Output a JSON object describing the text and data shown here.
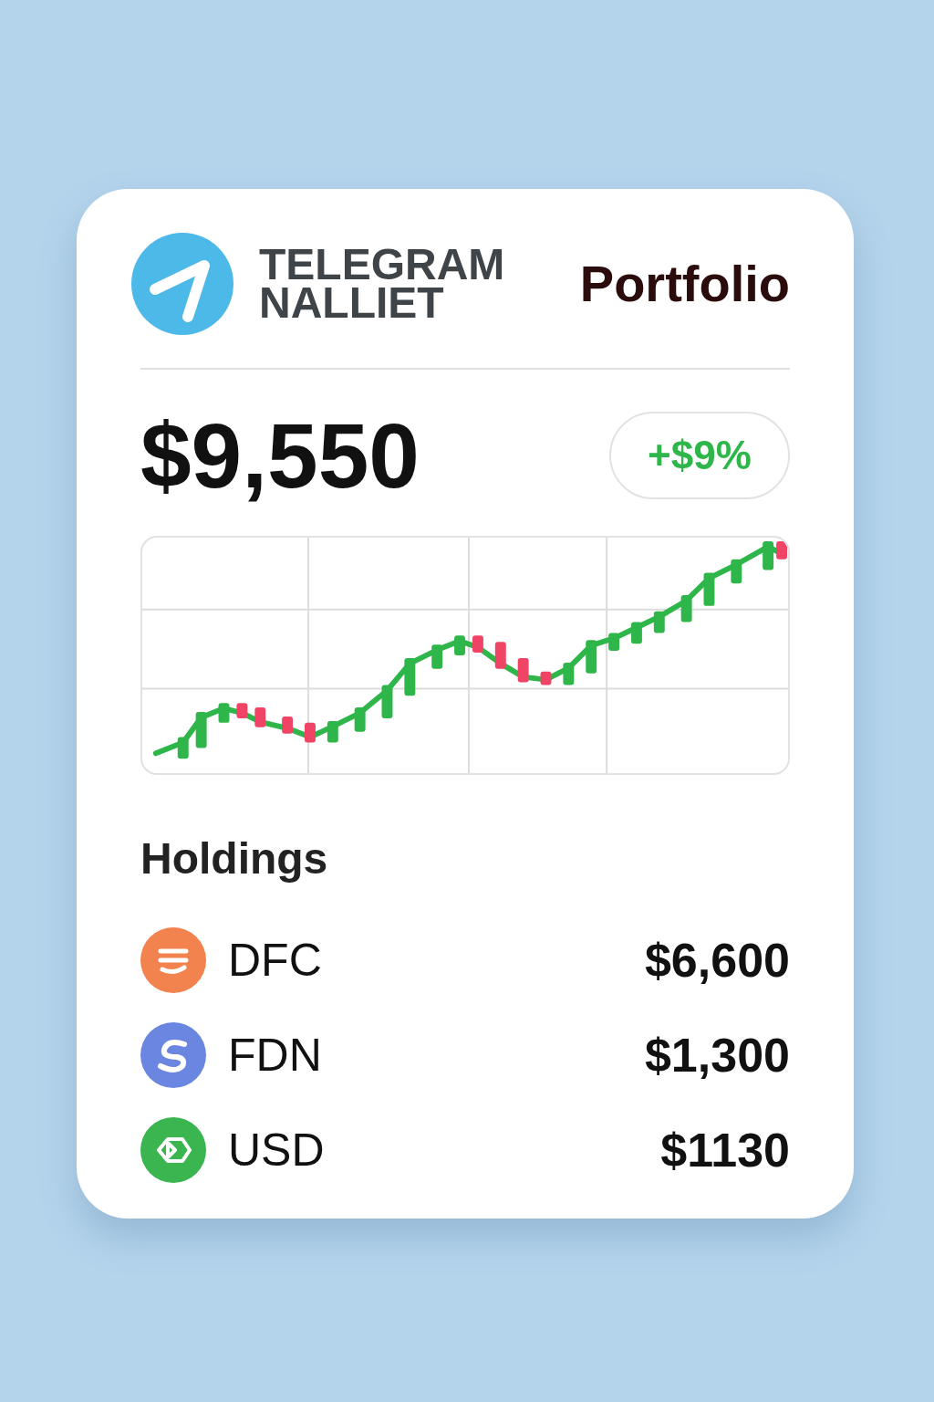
{
  "header": {
    "brand_line_1": "TELEGRAM",
    "brand_line_2": "NALLIET",
    "title": "Portfolio"
  },
  "balance": {
    "amount": "$9,550",
    "change": "+$9%"
  },
  "holdings": {
    "title": "Holdings",
    "items": [
      {
        "symbol": "DFC",
        "value": "$6,600",
        "color": "#f2834f"
      },
      {
        "symbol": "FDN",
        "value": "$1,300",
        "color": "#6b86e0"
      },
      {
        "symbol": "USD",
        "value": "$1130",
        "color": "#3bb54f"
      }
    ]
  }
}
